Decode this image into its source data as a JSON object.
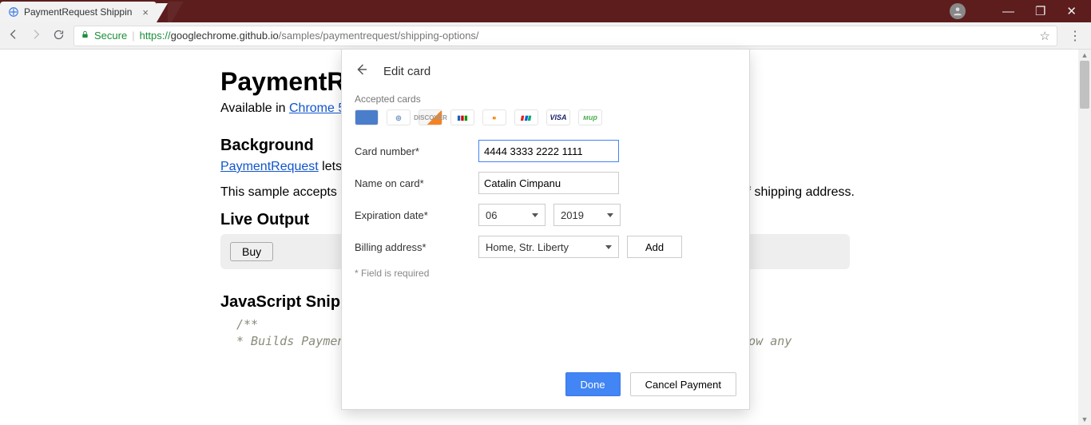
{
  "browser": {
    "tab_title": "PaymentRequest Shippin",
    "url_protocol": "https://",
    "url_host": "googlechrome.github.io",
    "url_path": "/samples/paymentrequest/shipping-options/",
    "secure_label": "Secure"
  },
  "win": {
    "minimize": "—",
    "maximize": "❐",
    "close": "✕"
  },
  "page": {
    "h1": "PaymentR",
    "sub_prefix": "Available in ",
    "sub_link": "Chrome 5",
    "h2a": "Background",
    "bg_link": "PaymentRequest",
    "bg_after": " lets ",
    "bg_p2a": "This sample accepts ",
    "bg_p2b": "ss of shipping address.",
    "h2b": "Live Output",
    "buy_label": "Buy",
    "h2c": "JavaScript Snipp",
    "code_l1": "/**",
    "code_l2": " * Builds PaymentRequest with multiple shipping options, but does not show any"
  },
  "sheet": {
    "title": "Edit card",
    "accepted_label": "Accepted cards",
    "card_brands": [
      "AMEX",
      "DINERS",
      "DISCOVER",
      "JCB",
      "MC",
      "UPAY",
      "VISA",
      "MIR"
    ],
    "labels": {
      "card_number": "Card number*",
      "name_on_card": "Name on card*",
      "exp_date": "Expiration date*",
      "billing": "Billing address*"
    },
    "values": {
      "card_number": "4444 3333 2222 1111",
      "name_on_card": "Catalin Cimpanu",
      "exp_month": "06",
      "exp_year": "2019",
      "billing": "Home, Str. Liberty"
    },
    "add_label": "Add",
    "required_note": "* Field is required",
    "done_label": "Done",
    "cancel_label": "Cancel Payment"
  }
}
